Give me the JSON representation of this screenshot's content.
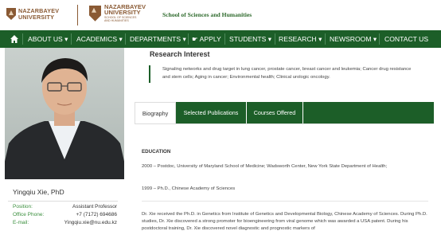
{
  "header": {
    "logo1": {
      "line1": "NAZARBAYEV",
      "line2": "UNIVERSITY"
    },
    "logo2": {
      "line1": "NAZARBAYEV",
      "line2": "UNIVERSITY",
      "line3": "SCHOOL OF SCIENCES",
      "line4": "AND HUMANITIES"
    },
    "school_name": "School of Sciences and Humanities"
  },
  "nav": {
    "items": [
      {
        "label": "ABOUT US ▾"
      },
      {
        "label": "ACADEMICS ▾"
      },
      {
        "label": "DEPARTMENTS ▾"
      },
      {
        "label": "☛ APPLY"
      },
      {
        "label": "STUDENTS ▾"
      },
      {
        "label": "RESEARCH ▾"
      },
      {
        "label": "NEWSROOM ▾"
      },
      {
        "label": "CONTACT US"
      }
    ]
  },
  "profile": {
    "name": "Yingqiu Xie, PhD",
    "rows": [
      {
        "label": "Position:",
        "value": "Assistant Professor"
      },
      {
        "label": "Office Phone:",
        "value": "+7 (7172) 694686"
      },
      {
        "label": "E-mail:",
        "value": "Yingqiu.xie@nu.edu.kz"
      }
    ]
  },
  "research_interest": {
    "title": "Research Interest",
    "text": "Signaling networks and drug target in lung cancer, prostate cancer, breast cancer and leukemia; Cancer drug resistance and stem cells; Aging in cancer; Environmental health; Clinical urologic oncology."
  },
  "tabs": [
    {
      "label": "Biography"
    },
    {
      "label": "Selected Publications"
    },
    {
      "label": "Courses Offered"
    }
  ],
  "biography": {
    "education_title": "EDUCATION",
    "entry1": "2000 – Postdoc, University of Maryland School of Medicine; Wadsworth Center, New York State Department of Health;",
    "entry2": "1999 – Ph.D., Chinese Academy of Sciences",
    "paragraph": "Dr. Xie received the Ph.D. in Genetics from Institute of Genetics and Developmental Biology, Chinese Academy of Sciences. During Ph.D. studies, Dr. Xie discovered a strong promoter for bioengineering from viral genome which was awarded a USA patent. During his postdoctoral training, Dr. Xie discovered novel diagnostic and prognostic markers of"
  },
  "colors": {
    "brand_green": "#1c5e28",
    "brand_brown": "#8a5a34",
    "label_green": "#3b8f3e"
  }
}
